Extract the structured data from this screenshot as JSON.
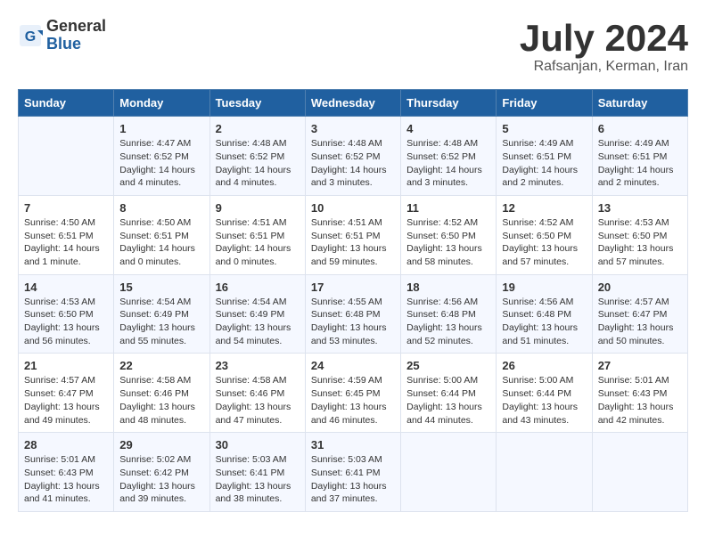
{
  "header": {
    "logo_general": "General",
    "logo_blue": "Blue",
    "month_title": "July 2024",
    "location": "Rafsanjan, Kerman, Iran"
  },
  "calendar": {
    "weekdays": [
      "Sunday",
      "Monday",
      "Tuesday",
      "Wednesday",
      "Thursday",
      "Friday",
      "Saturday"
    ],
    "weeks": [
      [
        {
          "day": "",
          "content": ""
        },
        {
          "day": "1",
          "content": "Sunrise: 4:47 AM\nSunset: 6:52 PM\nDaylight: 14 hours\nand 4 minutes."
        },
        {
          "day": "2",
          "content": "Sunrise: 4:48 AM\nSunset: 6:52 PM\nDaylight: 14 hours\nand 4 minutes."
        },
        {
          "day": "3",
          "content": "Sunrise: 4:48 AM\nSunset: 6:52 PM\nDaylight: 14 hours\nand 3 minutes."
        },
        {
          "day": "4",
          "content": "Sunrise: 4:48 AM\nSunset: 6:52 PM\nDaylight: 14 hours\nand 3 minutes."
        },
        {
          "day": "5",
          "content": "Sunrise: 4:49 AM\nSunset: 6:51 PM\nDaylight: 14 hours\nand 2 minutes."
        },
        {
          "day": "6",
          "content": "Sunrise: 4:49 AM\nSunset: 6:51 PM\nDaylight: 14 hours\nand 2 minutes."
        }
      ],
      [
        {
          "day": "7",
          "content": "Sunrise: 4:50 AM\nSunset: 6:51 PM\nDaylight: 14 hours\nand 1 minute."
        },
        {
          "day": "8",
          "content": "Sunrise: 4:50 AM\nSunset: 6:51 PM\nDaylight: 14 hours\nand 0 minutes."
        },
        {
          "day": "9",
          "content": "Sunrise: 4:51 AM\nSunset: 6:51 PM\nDaylight: 14 hours\nand 0 minutes."
        },
        {
          "day": "10",
          "content": "Sunrise: 4:51 AM\nSunset: 6:51 PM\nDaylight: 13 hours\nand 59 minutes."
        },
        {
          "day": "11",
          "content": "Sunrise: 4:52 AM\nSunset: 6:50 PM\nDaylight: 13 hours\nand 58 minutes."
        },
        {
          "day": "12",
          "content": "Sunrise: 4:52 AM\nSunset: 6:50 PM\nDaylight: 13 hours\nand 57 minutes."
        },
        {
          "day": "13",
          "content": "Sunrise: 4:53 AM\nSunset: 6:50 PM\nDaylight: 13 hours\nand 57 minutes."
        }
      ],
      [
        {
          "day": "14",
          "content": "Sunrise: 4:53 AM\nSunset: 6:50 PM\nDaylight: 13 hours\nand 56 minutes."
        },
        {
          "day": "15",
          "content": "Sunrise: 4:54 AM\nSunset: 6:49 PM\nDaylight: 13 hours\nand 55 minutes."
        },
        {
          "day": "16",
          "content": "Sunrise: 4:54 AM\nSunset: 6:49 PM\nDaylight: 13 hours\nand 54 minutes."
        },
        {
          "day": "17",
          "content": "Sunrise: 4:55 AM\nSunset: 6:48 PM\nDaylight: 13 hours\nand 53 minutes."
        },
        {
          "day": "18",
          "content": "Sunrise: 4:56 AM\nSunset: 6:48 PM\nDaylight: 13 hours\nand 52 minutes."
        },
        {
          "day": "19",
          "content": "Sunrise: 4:56 AM\nSunset: 6:48 PM\nDaylight: 13 hours\nand 51 minutes."
        },
        {
          "day": "20",
          "content": "Sunrise: 4:57 AM\nSunset: 6:47 PM\nDaylight: 13 hours\nand 50 minutes."
        }
      ],
      [
        {
          "day": "21",
          "content": "Sunrise: 4:57 AM\nSunset: 6:47 PM\nDaylight: 13 hours\nand 49 minutes."
        },
        {
          "day": "22",
          "content": "Sunrise: 4:58 AM\nSunset: 6:46 PM\nDaylight: 13 hours\nand 48 minutes."
        },
        {
          "day": "23",
          "content": "Sunrise: 4:58 AM\nSunset: 6:46 PM\nDaylight: 13 hours\nand 47 minutes."
        },
        {
          "day": "24",
          "content": "Sunrise: 4:59 AM\nSunset: 6:45 PM\nDaylight: 13 hours\nand 46 minutes."
        },
        {
          "day": "25",
          "content": "Sunrise: 5:00 AM\nSunset: 6:44 PM\nDaylight: 13 hours\nand 44 minutes."
        },
        {
          "day": "26",
          "content": "Sunrise: 5:00 AM\nSunset: 6:44 PM\nDaylight: 13 hours\nand 43 minutes."
        },
        {
          "day": "27",
          "content": "Sunrise: 5:01 AM\nSunset: 6:43 PM\nDaylight: 13 hours\nand 42 minutes."
        }
      ],
      [
        {
          "day": "28",
          "content": "Sunrise: 5:01 AM\nSunset: 6:43 PM\nDaylight: 13 hours\nand 41 minutes."
        },
        {
          "day": "29",
          "content": "Sunrise: 5:02 AM\nSunset: 6:42 PM\nDaylight: 13 hours\nand 39 minutes."
        },
        {
          "day": "30",
          "content": "Sunrise: 5:03 AM\nSunset: 6:41 PM\nDaylight: 13 hours\nand 38 minutes."
        },
        {
          "day": "31",
          "content": "Sunrise: 5:03 AM\nSunset: 6:41 PM\nDaylight: 13 hours\nand 37 minutes."
        },
        {
          "day": "",
          "content": ""
        },
        {
          "day": "",
          "content": ""
        },
        {
          "day": "",
          "content": ""
        }
      ]
    ]
  }
}
